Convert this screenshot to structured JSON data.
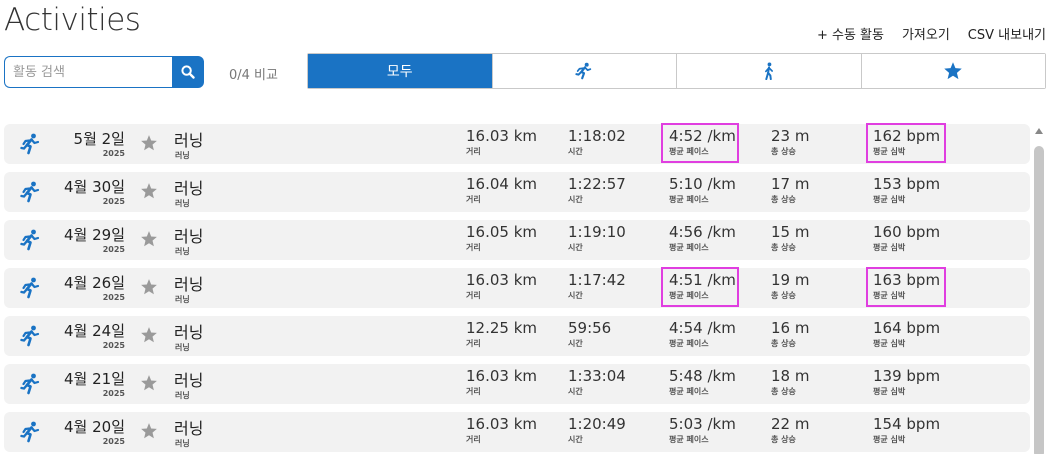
{
  "title": "Activities",
  "actions": {
    "manual": "+ 수동 활동",
    "import": "가져오기",
    "export": "CSV 내보내기"
  },
  "search": {
    "placeholder": "활동 검색",
    "value": ""
  },
  "compare": "0/4 비교",
  "filters": {
    "all": "모두",
    "run_icon": "running-person-icon",
    "walk_icon": "walking-person-icon",
    "fav_icon": "star-icon"
  },
  "labels": {
    "distance": "거리",
    "time": "시간",
    "pace": "평균 페이스",
    "elevation": "총 상승",
    "hr": "평균 심박"
  },
  "colors": {
    "accent": "#1a73c4",
    "highlight": "#e03ee0",
    "row_bg": "#f2f2f2",
    "star": "#9a9a9a"
  },
  "activities": [
    {
      "date": "5월 2일",
      "year": "2025",
      "name": "러닝",
      "type": "러닝",
      "distance": "16.03 km",
      "time": "1:18:02",
      "pace": "4:52 /km",
      "elevation": "23 m",
      "hr": "162 bpm",
      "highlighted": true
    },
    {
      "date": "4월 30일",
      "year": "2025",
      "name": "러닝",
      "type": "러닝",
      "distance": "16.04 km",
      "time": "1:22:57",
      "pace": "5:10 /km",
      "elevation": "17 m",
      "hr": "153 bpm",
      "highlighted": false
    },
    {
      "date": "4월 29일",
      "year": "2025",
      "name": "러닝",
      "type": "러닝",
      "distance": "16.05 km",
      "time": "1:19:10",
      "pace": "4:56 /km",
      "elevation": "15 m",
      "hr": "160 bpm",
      "highlighted": false
    },
    {
      "date": "4월 26일",
      "year": "2025",
      "name": "러닝",
      "type": "러닝",
      "distance": "16.03 km",
      "time": "1:17:42",
      "pace": "4:51 /km",
      "elevation": "19 m",
      "hr": "163 bpm",
      "highlighted": true
    },
    {
      "date": "4월 24일",
      "year": "2025",
      "name": "러닝",
      "type": "러닝",
      "distance": "12.25 km",
      "time": "59:56",
      "pace": "4:54 /km",
      "elevation": "16 m",
      "hr": "164 bpm",
      "highlighted": false
    },
    {
      "date": "4월 21일",
      "year": "2025",
      "name": "러닝",
      "type": "러닝",
      "distance": "16.03 km",
      "time": "1:33:04",
      "pace": "5:48 /km",
      "elevation": "18 m",
      "hr": "139 bpm",
      "highlighted": false
    },
    {
      "date": "4월 20일",
      "year": "2025",
      "name": "러닝",
      "type": "러닝",
      "distance": "16.03 km",
      "time": "1:20:49",
      "pace": "5:03 /km",
      "elevation": "22 m",
      "hr": "154 bpm",
      "highlighted": false
    }
  ]
}
